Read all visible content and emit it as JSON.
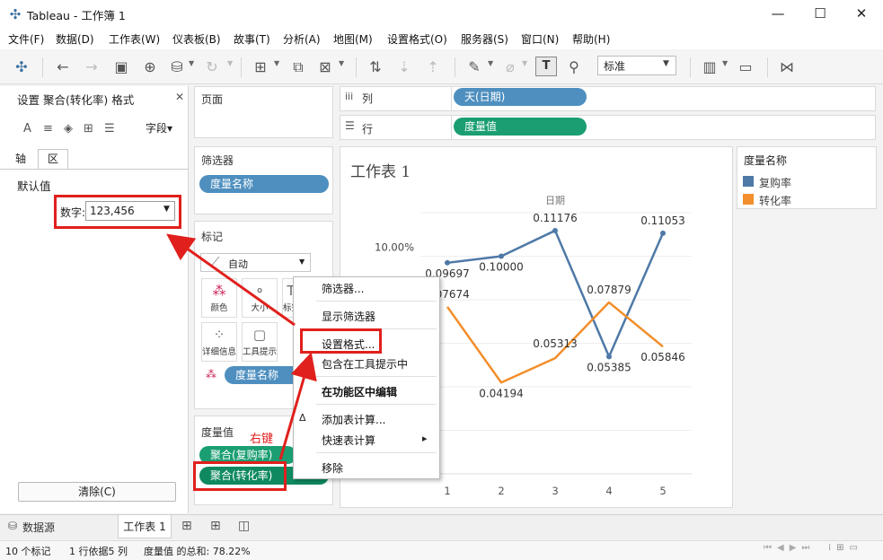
{
  "window": {
    "title": "Tableau - 工作簿 1",
    "minimize": "—",
    "maximize": "☐",
    "close": "✕"
  },
  "menu": [
    "文件(F)",
    "数据(D)",
    "工作表(W)",
    "仪表板(B)",
    "故事(T)",
    "分析(A)",
    "地图(M)",
    "设置格式(O)",
    "服务器(S)",
    "窗口(N)",
    "帮助(H)"
  ],
  "toolbar": {
    "fit_value": "标准"
  },
  "format_pane": {
    "title": "设置 聚合(转化率) 格式",
    "fields_label": "字段▾",
    "tabs": [
      "轴",
      "区"
    ],
    "section": "默认值",
    "number_label": "数字:",
    "number_value": "123,456",
    "clear_label": "清除(C)"
  },
  "pages_label": "页面",
  "columns": {
    "label": "列",
    "pill": "天(日期)"
  },
  "rows": {
    "label": "行",
    "pill": "度量值"
  },
  "filters": {
    "label": "筛选器",
    "pill": "度量名称"
  },
  "marks": {
    "label": "标记",
    "type": "自动",
    "cards": [
      "颜色",
      "大小",
      "标签",
      "详细信息",
      "工具提示"
    ],
    "color_pill": "度量名称"
  },
  "measure_values": {
    "label": "度量值",
    "pills": [
      "聚合(复购率)",
      "聚合(转化率)"
    ]
  },
  "annotation": {
    "right_click": "右键"
  },
  "context_menu": {
    "items": [
      "筛选器...",
      "显示筛选器",
      "设置格式...",
      "包含在工具提示中",
      "在功能区中编辑",
      "添加表计算...",
      "快速表计算",
      "移除"
    ],
    "submenu_arrow": "▸",
    "check": "✓",
    "delta": "Δ"
  },
  "legend": {
    "title": "度量名称",
    "items": [
      {
        "label": "复购率",
        "color": "#4e79a7"
      },
      {
        "label": "转化率",
        "color": "#f28e2b"
      }
    ]
  },
  "bottom_tabs": {
    "datasource": "数据源",
    "sheet": "工作表 1"
  },
  "status": {
    "marks": "10 个标记",
    "rows_cols": "1 行依据5 列",
    "sum": "度量值 的总和: 78.22%"
  },
  "chart_data": {
    "type": "line",
    "title": "工作表 1",
    "xlabel": "日期",
    "categories": [
      "1",
      "2",
      "3",
      "4",
      "5"
    ],
    "y_tick_label": "10.00%",
    "series": [
      {
        "name": "复购率",
        "color": "#4e79a7",
        "values": [
          0.09697,
          0.1,
          0.11176,
          0.05385,
          0.11053
        ],
        "labels": [
          "0.09697",
          "0.10000",
          "0.11176",
          "0.05385",
          "0.11053"
        ]
      },
      {
        "name": "转化率",
        "color": "#f28e2b",
        "values": [
          0.07674,
          0.04194,
          0.05313,
          0.07879,
          0.05846
        ],
        "labels": [
          "0.07674",
          "0.04194",
          "0.05313",
          "0.07879",
          "0.05846"
        ]
      }
    ]
  }
}
